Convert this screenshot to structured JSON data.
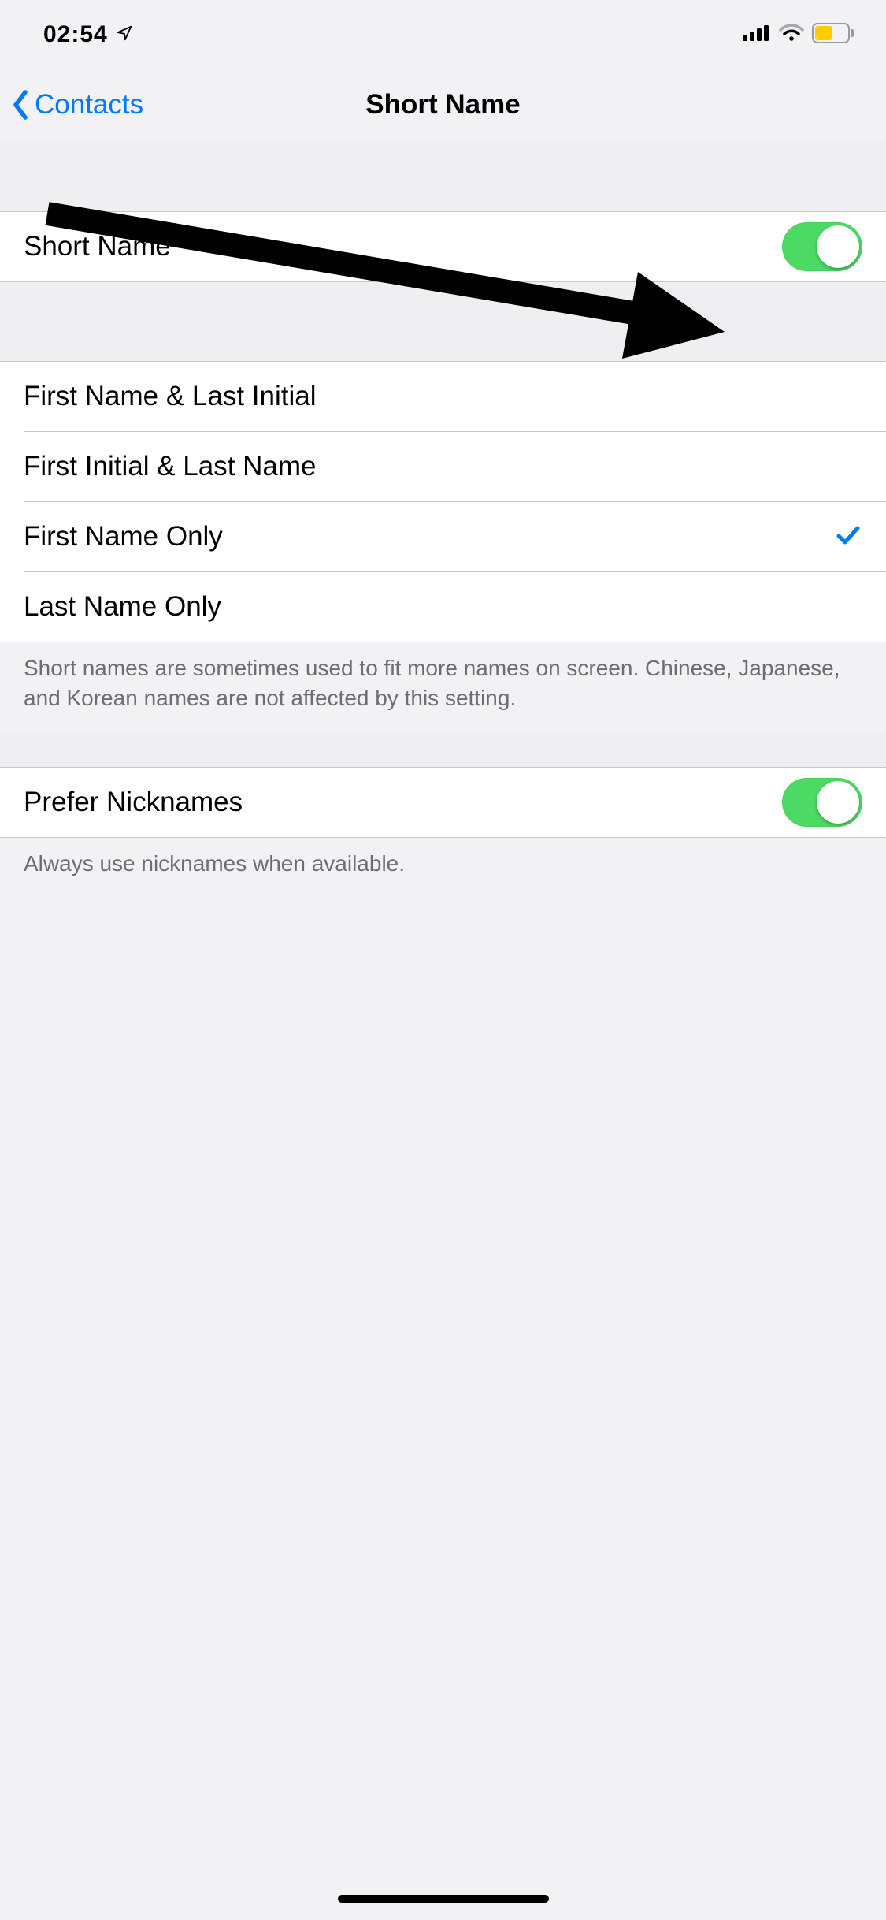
{
  "status": {
    "time": "02:54"
  },
  "nav": {
    "back_label": "Contacts",
    "title": "Short Name"
  },
  "toggles": {
    "short_name": {
      "label": "Short Name",
      "on": true
    },
    "prefer_nicknames": {
      "label": "Prefer Nicknames",
      "on": true
    }
  },
  "options": [
    {
      "label": "First Name & Last Initial",
      "selected": false
    },
    {
      "label": "First Initial & Last Name",
      "selected": false
    },
    {
      "label": "First Name Only",
      "selected": true
    },
    {
      "label": "Last Name Only",
      "selected": false
    }
  ],
  "footers": {
    "options": "Short names are sometimes used to fit more names on screen. Chinese, Japanese, and Korean names are not affected by this setting.",
    "nicknames": "Always use nicknames when available."
  }
}
